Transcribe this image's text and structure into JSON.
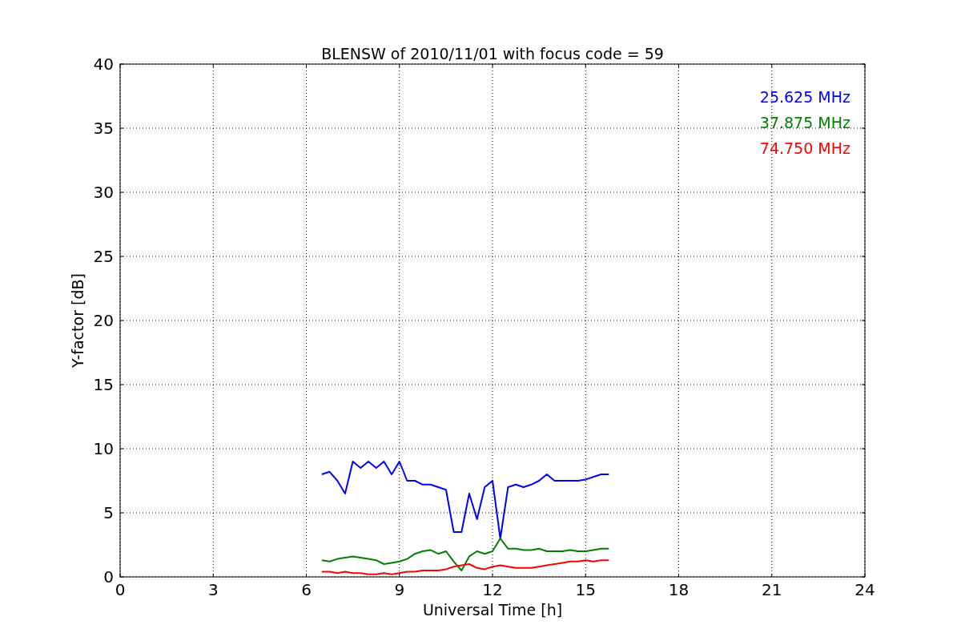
{
  "chart_data": {
    "type": "line",
    "title": "BLENSW of 2010/11/01 with focus code = 59",
    "xlabel": "Universal Time [h]",
    "ylabel": "Y-factor [dB]",
    "x": [
      6.5,
      6.75,
      7.0,
      7.25,
      7.5,
      7.75,
      8.0,
      8.25,
      8.5,
      8.75,
      9.0,
      9.25,
      9.5,
      9.75,
      10.0,
      10.25,
      10.5,
      10.75,
      11.0,
      11.25,
      11.5,
      11.75,
      12.0,
      12.25,
      12.5,
      12.75,
      13.0,
      13.25,
      13.5,
      13.75,
      14.0,
      14.25,
      14.5,
      14.75,
      15.0,
      15.25,
      15.5,
      15.75
    ],
    "series": [
      {
        "name": "25.625 MHz",
        "color": "#0000ff",
        "values": [
          8.0,
          8.2,
          7.5,
          6.5,
          9.0,
          8.5,
          9.0,
          8.5,
          9.0,
          8.0,
          9.0,
          7.5,
          7.5,
          7.2,
          7.2,
          7.0,
          6.8,
          3.5,
          3.5,
          6.5,
          4.5,
          7.0,
          7.5,
          3.0,
          7.0,
          7.2,
          7.0,
          7.2,
          7.5,
          8.0,
          7.5,
          7.5,
          7.5,
          7.5,
          7.6,
          7.8,
          8.0,
          8.0
        ]
      },
      {
        "name": "37.875 MHz",
        "color": "#008000",
        "values": [
          1.3,
          1.2,
          1.4,
          1.5,
          1.6,
          1.5,
          1.4,
          1.3,
          1.0,
          1.1,
          1.2,
          1.4,
          1.8,
          2.0,
          2.1,
          1.8,
          2.0,
          1.2,
          0.5,
          1.6,
          2.0,
          1.8,
          2.0,
          3.0,
          2.2,
          2.2,
          2.1,
          2.1,
          2.2,
          2.0,
          2.0,
          2.0,
          2.1,
          2.0,
          2.0,
          2.1,
          2.2,
          2.2
        ]
      },
      {
        "name": "74.750 MHz",
        "color": "#ff0000",
        "values": [
          0.4,
          0.4,
          0.3,
          0.4,
          0.3,
          0.3,
          0.2,
          0.2,
          0.3,
          0.2,
          0.3,
          0.4,
          0.4,
          0.5,
          0.5,
          0.5,
          0.6,
          0.8,
          0.9,
          1.0,
          0.7,
          0.6,
          0.8,
          0.9,
          0.8,
          0.7,
          0.7,
          0.7,
          0.8,
          0.9,
          1.0,
          1.1,
          1.2,
          1.2,
          1.3,
          1.2,
          1.3,
          1.3
        ]
      }
    ],
    "xlim": [
      0,
      24
    ],
    "ylim": [
      0,
      40
    ],
    "xticks": [
      0,
      3,
      6,
      9,
      12,
      15,
      18,
      21,
      24
    ],
    "yticks": [
      0,
      5,
      10,
      15,
      20,
      25,
      30,
      35,
      40
    ],
    "grid": true
  }
}
